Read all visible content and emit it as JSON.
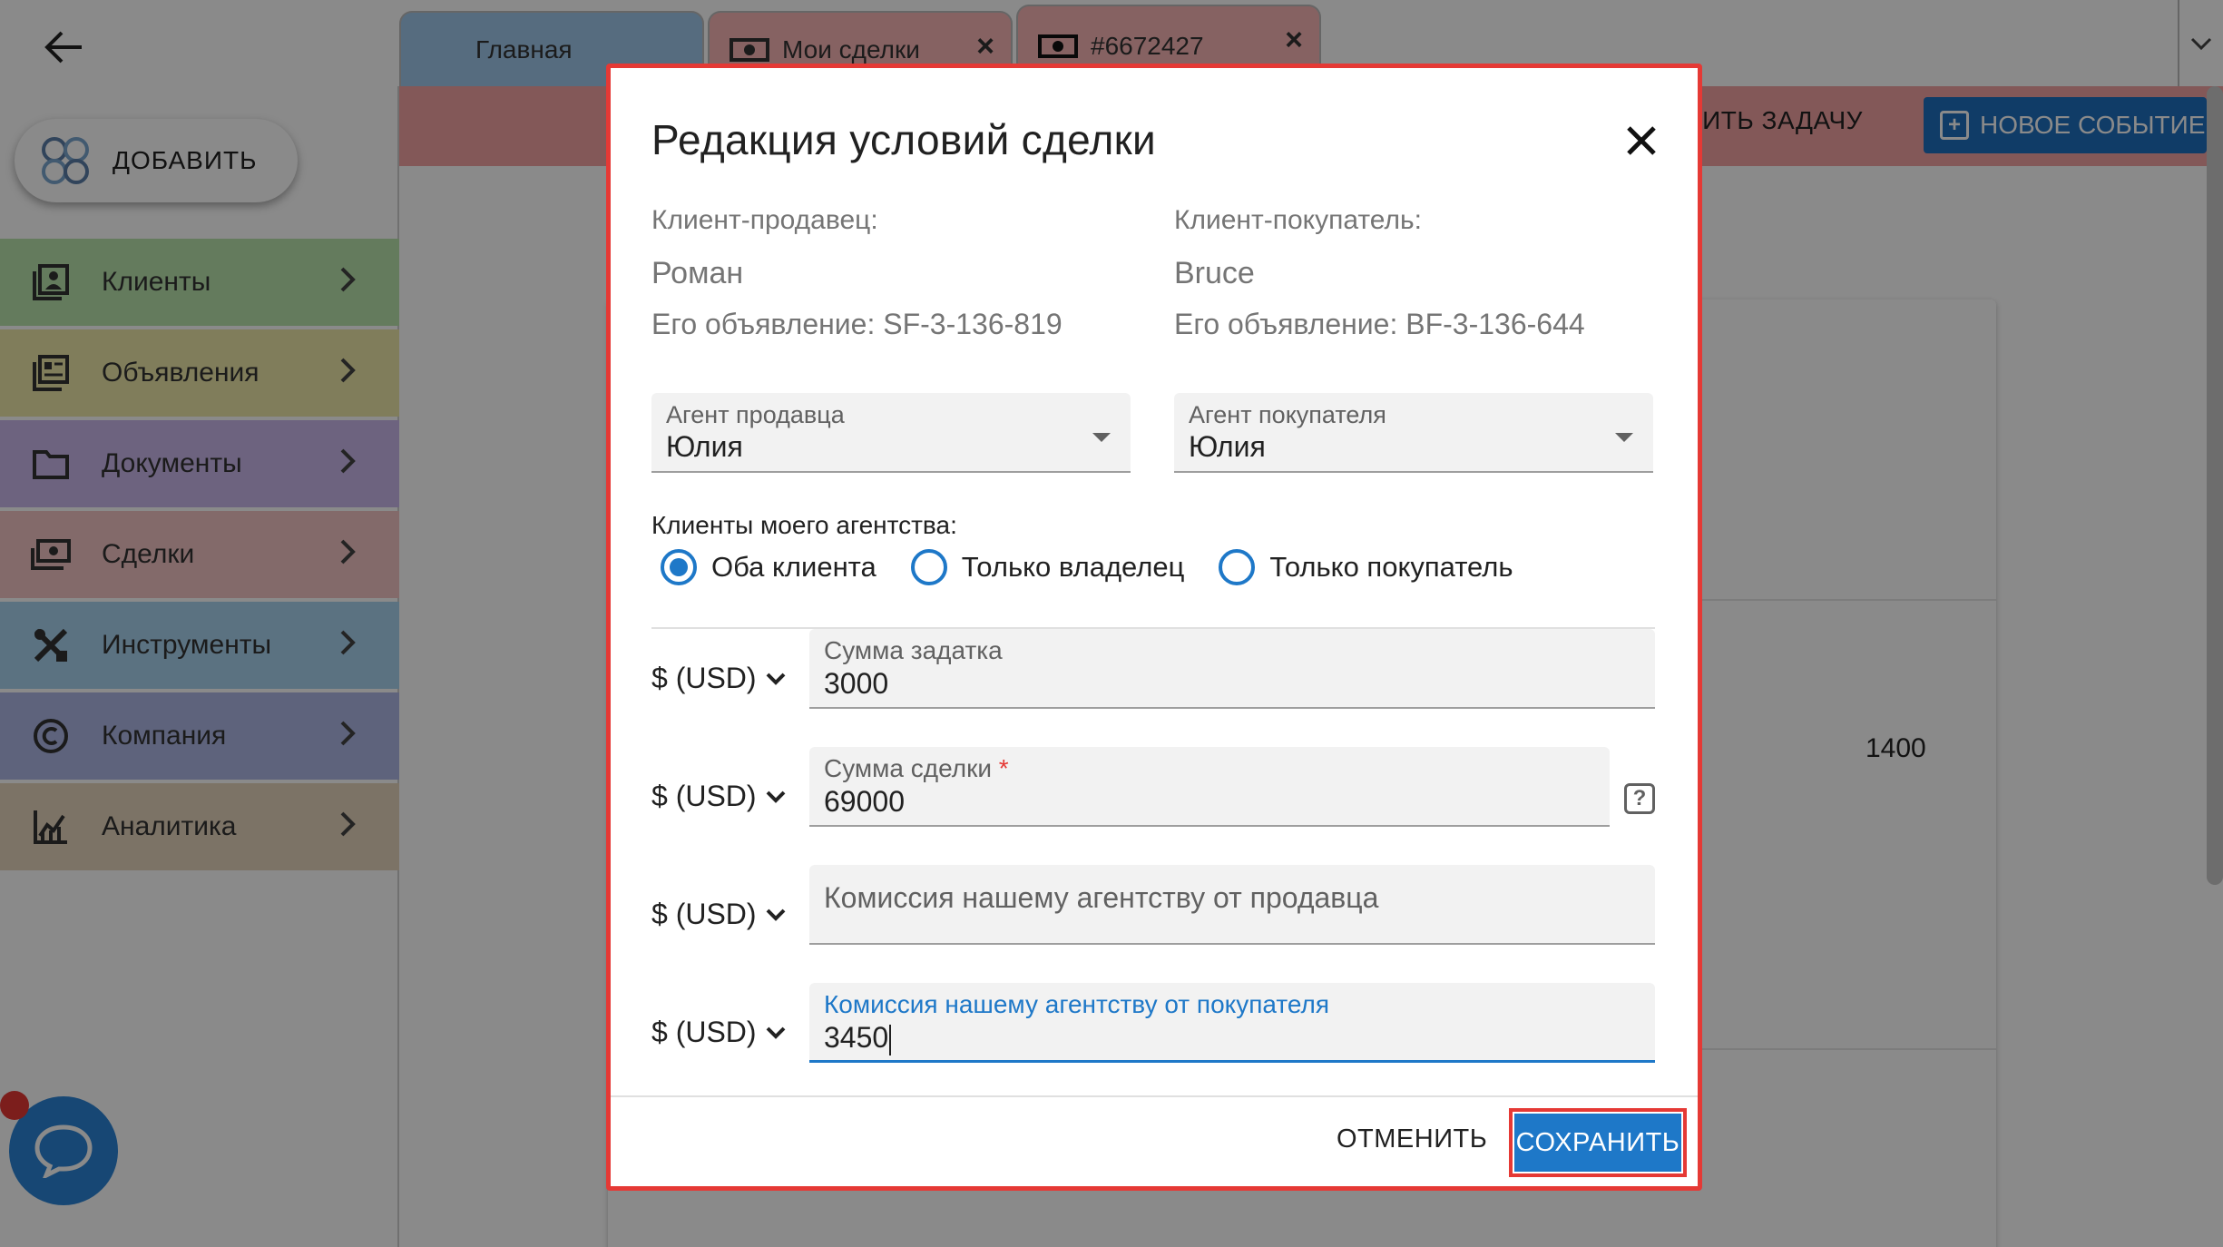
{
  "tabs": [
    {
      "label": "Главная",
      "closable": false
    },
    {
      "label": "Мои сделки",
      "closable": true
    },
    {
      "label": "#6672427",
      "closable": true
    }
  ],
  "actionbar": {
    "task_label": "АЧИТЬ ЗАДАЧУ",
    "event_label": "НОВОЕ СОБЫТИЕ"
  },
  "sidebar": {
    "add_label": "ДОБАВИТЬ",
    "items": [
      {
        "label": "Клиенты",
        "icon": "contacts-icon",
        "color": "#b9e3ad"
      },
      {
        "label": "Объявления",
        "icon": "listings-icon",
        "color": "#ece8a8"
      },
      {
        "label": "Документы",
        "icon": "folder-icon",
        "color": "#c9b8ea"
      },
      {
        "label": "Сделки",
        "icon": "cash-icon",
        "color": "#f2c4c4"
      },
      {
        "label": "Инструменты",
        "icon": "tools-icon",
        "color": "#a9d2ef"
      },
      {
        "label": "Компания",
        "icon": "copyright-icon",
        "color": "#aeb8e6"
      },
      {
        "label": "Аналитика",
        "icon": "analytics-icon",
        "color": "#e6d4bd"
      }
    ]
  },
  "content": {
    "number": "1400"
  },
  "dialog": {
    "title": "Редакция условий сделки",
    "seller": {
      "label": "Клиент-продавец:",
      "name": "Роман",
      "listing": "Его объявление: SF-3-136-819"
    },
    "buyer": {
      "label": "Клиент-покупатель:",
      "name": "Bruce",
      "listing": "Его объявление: BF-3-136-644"
    },
    "seller_agent": {
      "label": "Агент продавца",
      "value": "Юлия"
    },
    "buyer_agent": {
      "label": "Агент покупателя",
      "value": "Юлия"
    },
    "clients_caption": "Клиенты моего агентства:",
    "radio_options": [
      {
        "label": "Оба клиента",
        "selected": true
      },
      {
        "label": "Только владелец",
        "selected": false
      },
      {
        "label": "Только покупатель",
        "selected": false
      }
    ],
    "currency_label": "$ (USD)",
    "deposit": {
      "label": "Сумма задатка",
      "value": "3000"
    },
    "deal_amount": {
      "label": "Сумма сделки",
      "required_mark": "*",
      "value": "69000"
    },
    "seller_commission": {
      "placeholder": "Комиссия нашему агентству от продавца"
    },
    "buyer_commission": {
      "label": "Комиссия нашему агентству от покупателя",
      "value": "3450"
    },
    "help_symbol": "?",
    "cancel_label": "ОТМЕНИТЬ",
    "save_label": "СОХРАНИТЬ"
  },
  "colors": {
    "accent": "#1e78c8",
    "highlight": "#e53935",
    "tab_home": "#9fc7ea",
    "tab_deals": "#f7b6b6"
  }
}
